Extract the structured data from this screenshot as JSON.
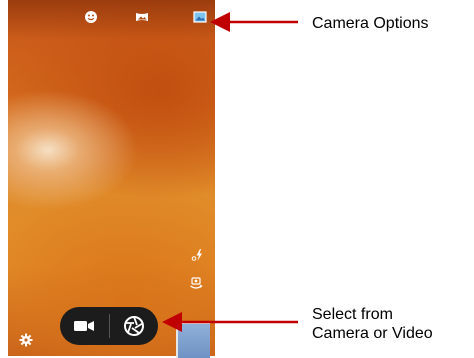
{
  "screen": {
    "top_icons": [
      "face-icon",
      "panorama-icon",
      "picture-icon"
    ],
    "side_icons": [
      "flash-icon",
      "switch-camera-icon"
    ],
    "bottom": {
      "settings_icon": "gear-icon",
      "video_icon": "video-camera-icon",
      "shutter_icon": "shutter-icon",
      "thumbnail": "gallery-thumbnail"
    }
  },
  "annotations": {
    "camera_options": "Camera Options",
    "select_line1": "Select from",
    "select_line2": "Camera or Video"
  },
  "colors": {
    "arrow": "#c00000",
    "pill": "#1c1c1c",
    "thumbnail": "#7c9fcf"
  }
}
